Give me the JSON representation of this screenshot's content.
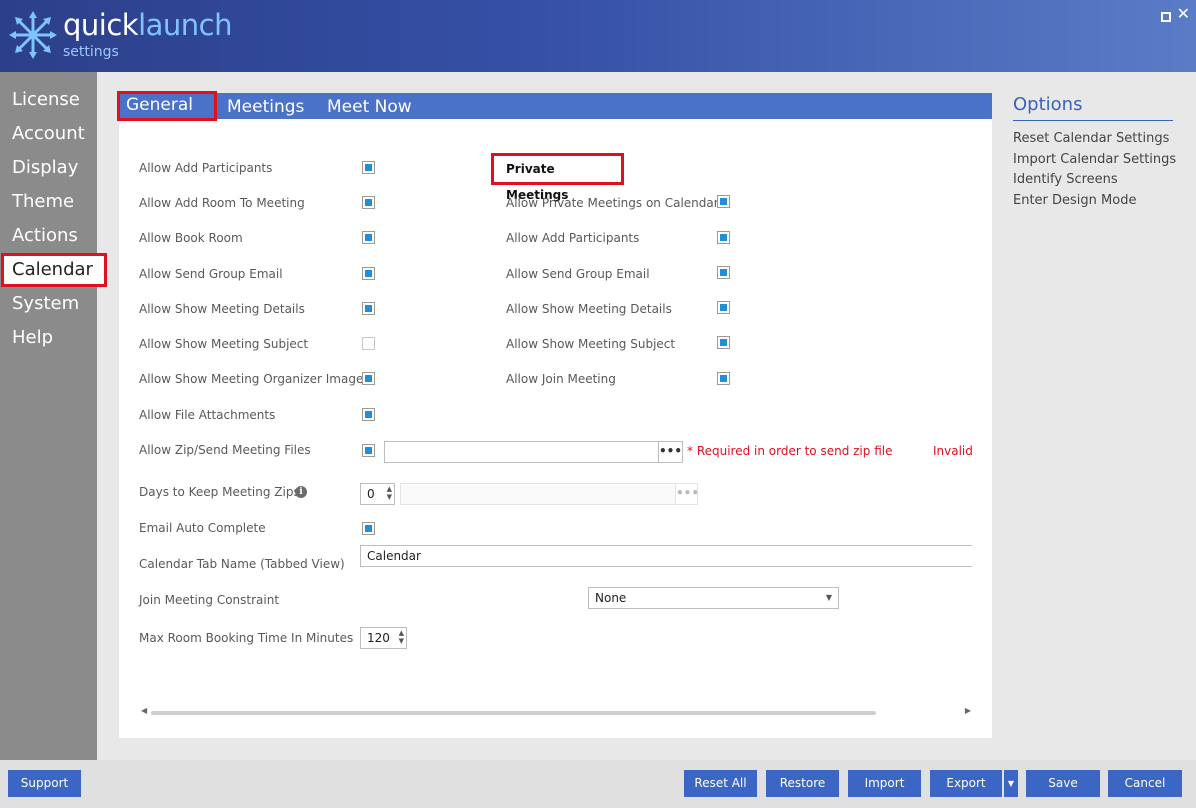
{
  "header": {
    "logo_quick": "quick",
    "logo_launch": "launch",
    "logo_sub": "settings"
  },
  "sidebar": {
    "items": [
      {
        "label": "License"
      },
      {
        "label": "Account"
      },
      {
        "label": "Display"
      },
      {
        "label": "Theme"
      },
      {
        "label": "Actions"
      },
      {
        "label": "Calendar"
      },
      {
        "label": "System"
      },
      {
        "label": "Help"
      }
    ],
    "active": "Calendar"
  },
  "tabs": [
    {
      "label": "General"
    },
    {
      "label": "Meetings"
    },
    {
      "label": "Meet Now"
    }
  ],
  "general": {
    "left": [
      {
        "label": "Allow Add Participants",
        "checked": true
      },
      {
        "label": "Allow Add Room To Meeting",
        "checked": true
      },
      {
        "label": "Allow Book Room",
        "checked": true
      },
      {
        "label": "Allow Send Group Email",
        "checked": true
      },
      {
        "label": "Allow Show Meeting Details",
        "checked": true
      },
      {
        "label": "Allow Show Meeting Subject",
        "checked": false
      },
      {
        "label": "Allow Show Meeting Organizer Image",
        "checked": true
      },
      {
        "label": "Allow File Attachments",
        "checked": true
      },
      {
        "label": "Allow Zip/Send Meeting Files",
        "checked": true
      }
    ],
    "private_title": "Private Meetings",
    "right": [
      {
        "label": "Allow Private Meetings on Calendar",
        "checked": true
      },
      {
        "label": "Allow Add Participants",
        "checked": true
      },
      {
        "label": "Allow Send Group Email",
        "checked": true
      },
      {
        "label": "Allow Show Meeting Details",
        "checked": true
      },
      {
        "label": "Allow Show Meeting Subject",
        "checked": true
      },
      {
        "label": "Allow Join Meeting",
        "checked": true
      }
    ],
    "zip_path_value": "",
    "browse_label": "•••",
    "required_text": "* Required in order to send zip file",
    "invalid_text": "Invalid",
    "days_label": "Days to Keep Meeting Zips",
    "days_value": "0",
    "disabled_browse_label": "•••",
    "email_auto_label": "Email Auto Complete",
    "email_auto_checked": true,
    "tab_name_label": "Calendar Tab Name (Tabbed View)",
    "tab_name_value": "Calendar",
    "join_label": "Join Meeting Constraint",
    "join_value": "None",
    "max_room_label": "Max Room Booking Time In Minutes",
    "max_room_value": "120"
  },
  "options": {
    "title": "Options",
    "links": [
      {
        "label": "Reset Calendar Settings"
      },
      {
        "label": "Import Calendar Settings"
      },
      {
        "label": "Identify Screens"
      },
      {
        "label": "Enter Design Mode"
      }
    ]
  },
  "footer": {
    "support": "Support",
    "reset_all": "Reset All",
    "restore": "Restore",
    "import": "Import",
    "export": "Export",
    "save": "Save",
    "cancel": "Cancel"
  },
  "colors": {
    "accent": "#4b72c9",
    "highlight": "#e0101e",
    "checkbox": "#1e8fd8"
  }
}
